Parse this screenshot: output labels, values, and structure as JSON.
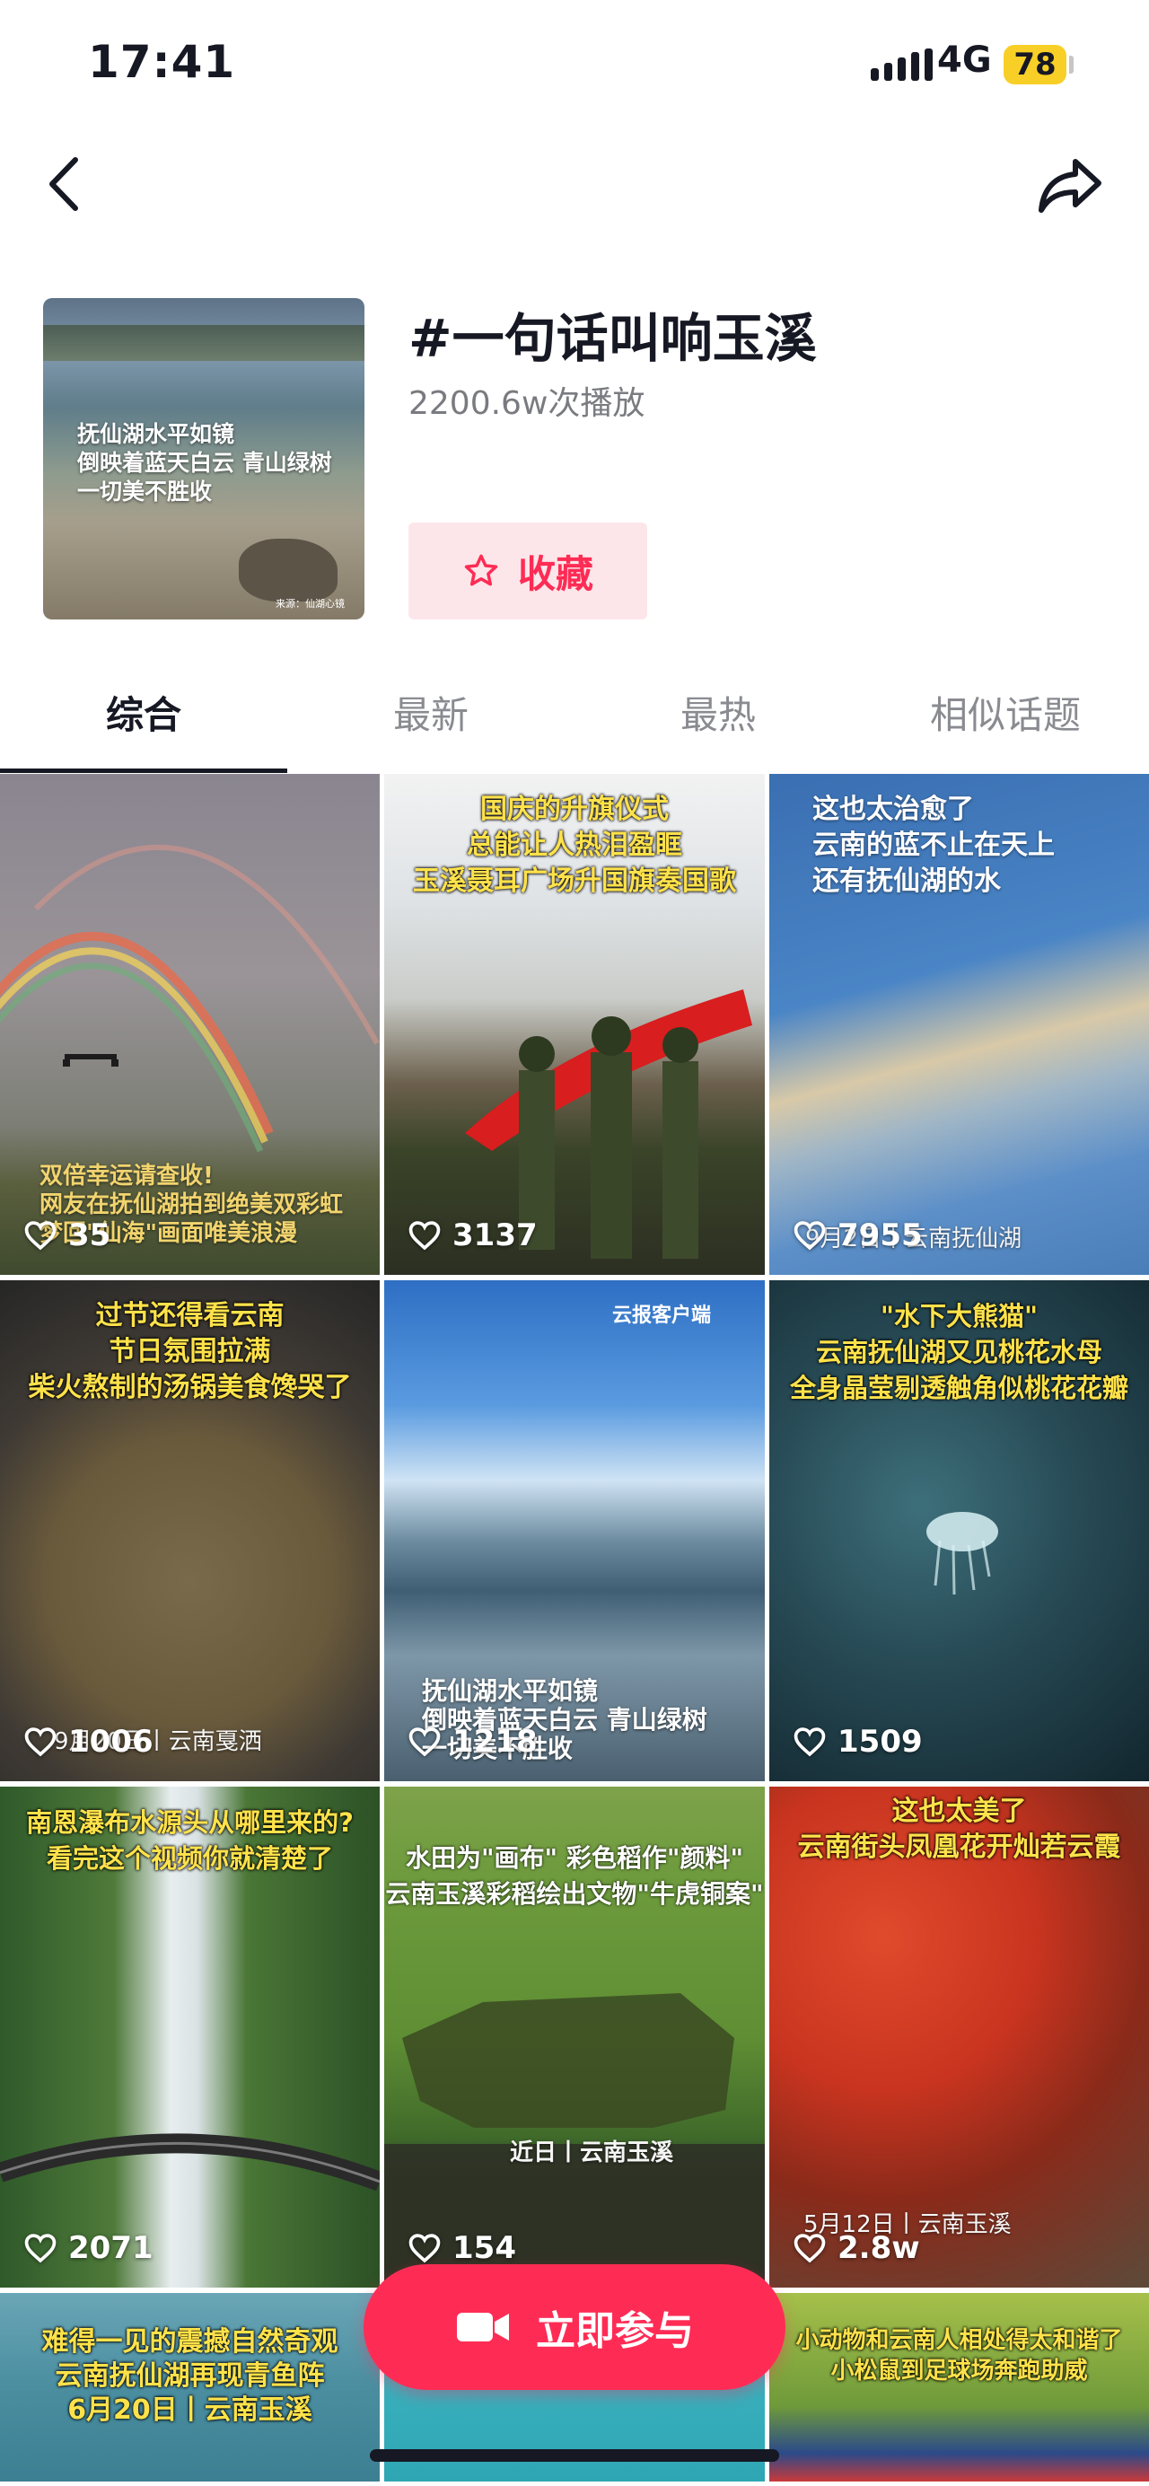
{
  "status_bar": {
    "time": "17:41",
    "network": "4G",
    "battery": "78"
  },
  "topic": {
    "title": "#一句话叫响玉溪",
    "plays": "2200.6w次播放",
    "collect_label": "收藏",
    "cover_text": "抚仙湖水平如镜\n倒映着蓝天白云 青山绿树\n一切美不胜收",
    "cover_source": "来源：仙湖心镜"
  },
  "tabs": [
    "综合",
    "最新",
    "最热",
    "相似话题"
  ],
  "videos": [
    {
      "overlay": "",
      "caption": "双倍幸运请查收!\n网友在抚仙湖拍到绝美双彩虹\n梦回\"仙海\"画面唯美浪漫",
      "likes": "35"
    },
    {
      "overlay": "国庆的升旗仪式\n总能让人热泪盈眶\n玉溪聂耳广场升国旗奏国歌",
      "caption": "",
      "likes": "3137"
    },
    {
      "overlay": "这也太治愈了\n云南的蓝不止在天上\n还有抚仙湖的水",
      "caption": "9月2日丨云南抚仙湖",
      "likes": "7955"
    },
    {
      "overlay": "过节还得看云南\n节日氛围拉满\n柴火熬制的汤锅美食馋哭了",
      "caption": "9月20日丨云南戛洒",
      "likes": "1006"
    },
    {
      "overlay": "云报客户端",
      "caption": "抚仙湖水平如镜\n倒映着蓝天白云 青山绿树\n一切美不胜收",
      "likes": "1218"
    },
    {
      "overlay": "\"水下大熊猫\"\n云南抚仙湖又见桃花水母\n全身晶莹剔透触角似桃花花瓣",
      "caption": "",
      "likes": "1509"
    },
    {
      "overlay": "南恩瀑布水源头从哪里来的?\n看完这个视频你就清楚了",
      "caption": "",
      "likes": "2071"
    },
    {
      "overlay": "水田为\"画布\" 彩色稻作\"颜料\"\n云南玉溪彩稻绘出文物\"牛虎铜案\"",
      "caption": "近日丨云南玉溪",
      "likes": "154"
    },
    {
      "overlay": "这也太美了\n云南街头凤凰花开灿若云霞",
      "caption": "5月12日丨云南玉溪",
      "likes": "2.8w"
    },
    {
      "overlay": "难得一见的震撼自然奇观\n云南抚仙湖再现青鱼阵\n6月20日丨云南玉溪",
      "caption": "",
      "likes": ""
    },
    {
      "overlay": "",
      "caption": "",
      "likes": ""
    },
    {
      "overlay": "小动物和云南人相处得太和谐了\n小松鼠到足球场奔跑助威",
      "caption": "",
      "likes": ""
    }
  ],
  "join_button": {
    "label": "立即参与"
  }
}
